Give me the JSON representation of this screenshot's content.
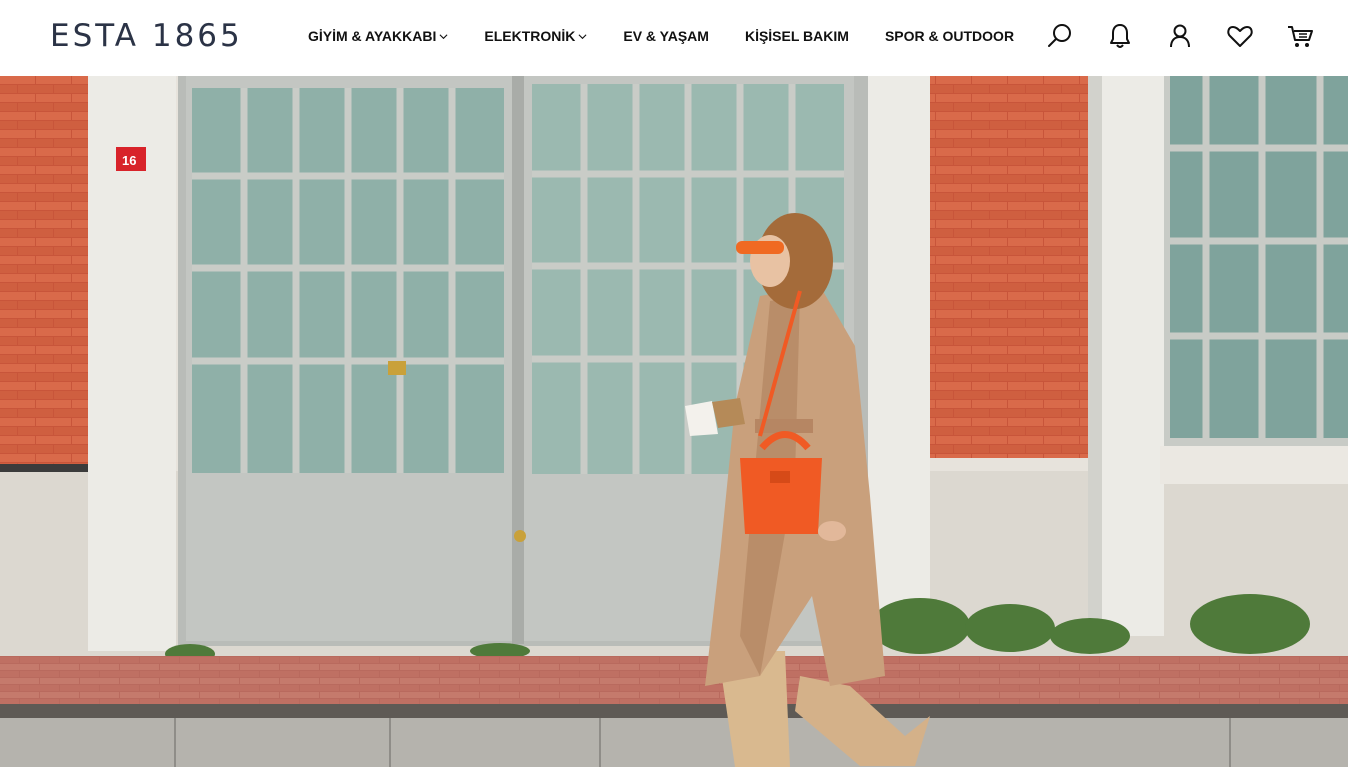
{
  "header": {
    "logo": "ESTA 1865",
    "nav": [
      {
        "label": "GİYİM & AYAKKABI",
        "has_dropdown": true
      },
      {
        "label": "ELEKTRONİK",
        "has_dropdown": true
      },
      {
        "label": "EV & YAŞAM",
        "has_dropdown": false
      },
      {
        "label": "KİŞİSEL BAKIM",
        "has_dropdown": false
      },
      {
        "label": "SPOR & OUTDOOR",
        "has_dropdown": false
      }
    ],
    "icons": [
      "search-icon",
      "bell-icon",
      "user-icon",
      "heart-icon",
      "cart-icon"
    ]
  },
  "hero": {
    "door_number": "16"
  },
  "colors": {
    "logo": "#2b3346",
    "nav_text": "#111111",
    "brick": "#c8553a",
    "glass": "#8fb0a8",
    "bag": "#f05a24",
    "coat": "#c9a07c"
  }
}
